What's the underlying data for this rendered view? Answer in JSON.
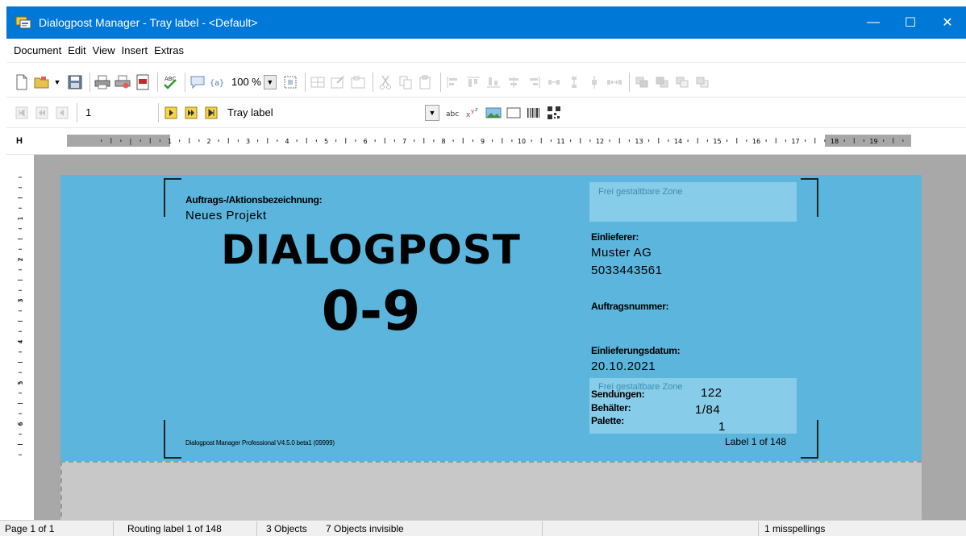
{
  "window": {
    "title": "Dialogpost Manager - Tray label - <Default>",
    "controls": {
      "minimize": "—",
      "maximize": "☐",
      "close": "✕"
    },
    "accent_color": "#0078d7"
  },
  "menubar": {
    "items": [
      "Document",
      "Edit",
      "View",
      "Insert",
      "Extras"
    ]
  },
  "toolbar1": {
    "zoom": "100 %"
  },
  "toolbar2": {
    "page_number": "1",
    "layout_select": "Tray label"
  },
  "ruler": {
    "h_marker": "H"
  },
  "label": {
    "background_color": "#5bb5dc",
    "auftrag_label": "Auftrags-/Aktionsbezeichnung:",
    "auftrag_value": "Neues Projekt",
    "big_title": "DIALOGPOST",
    "big_subtitle": "0-9",
    "zone_top": "Frei gestaltbare Zone",
    "einlieferer_label": "Einlieferer:",
    "einlieferer_name": "Muster AG",
    "einlieferer_number": "5033443561",
    "auftragsnummer_label": "Auftragsnummer:",
    "einlieferungsdatum_label": "Einlieferungsdatum:",
    "einlieferungsdatum_value": "20.10.2021",
    "zone_bottom": "Frei gestaltbare Zone",
    "sendungen_label": "Sendungen:",
    "sendungen_value": "122",
    "behaelter_label": "Behälter:",
    "behaelter_value": "1/84",
    "palette_label": "Palette:",
    "palette_value": "1",
    "footer_left": "Dialogpost Manager Professional V4.5.0 beta1 (09999)",
    "footer_right": "Label 1 of 148"
  },
  "statusbar": {
    "page": "Page 1 of 1",
    "routing": "Routing label 1 of 148",
    "objects": "3 Objects",
    "invisible": "7 Objects invisible",
    "misspellings": "1 misspellings"
  }
}
